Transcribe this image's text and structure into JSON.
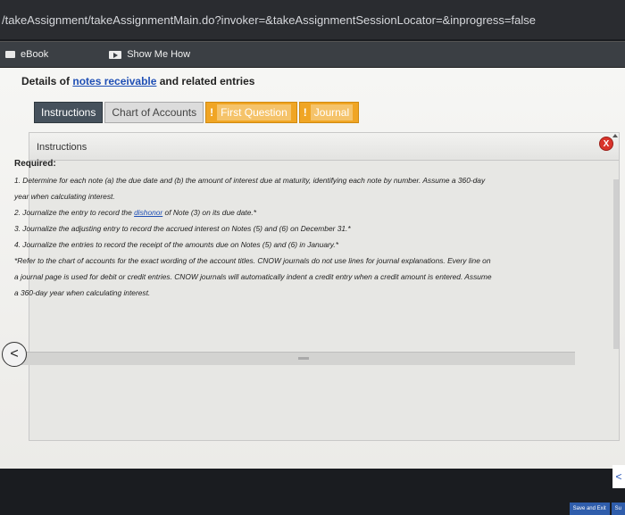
{
  "browser": {
    "url": "/takeAssignment/takeAssignmentMain.do?invoker=&takeAssignmentSessionLocator=&inprogress=false"
  },
  "toolbar": {
    "ebook_label": "eBook",
    "showme_label": "Show Me How"
  },
  "heading": {
    "prefix": "Details of ",
    "link": "notes receivable",
    "suffix": " and related entries"
  },
  "tabs": [
    {
      "label": "Instructions"
    },
    {
      "label": "Chart of Accounts"
    },
    {
      "bang": "!",
      "label": "First Question"
    },
    {
      "bang": "!",
      "label": "Journal"
    }
  ],
  "panel": {
    "title": "Instructions",
    "close_glyph": "X"
  },
  "content": {
    "required": "Required:",
    "line1": "1. Determine for each note (a) the due date and (b) the amount of interest due at maturity, identifying each note by number. Assume a 360-day",
    "line1b": "year when calculating interest.",
    "line2a": "2. Journalize the entry to record the ",
    "line2link": "dishonor",
    "line2b": " of Note (3) on its due date.*",
    "line3": "3. Journalize the adjusting entry to record the accrued interest on Notes (5) and (6) on December 31.*",
    "line4": "4. Journalize the entries to record the receipt of the amounts due on Notes (5) and (6) in January.*",
    "line5": "*Refer to the chart of accounts for the exact wording of the account titles. CNOW journals do not use lines for journal explanations. Every line on",
    "line6": "a journal page is used for debit or credit entries. CNOW journals will automatically indent a credit entry when a credit amount is entered. Assume",
    "line7": "a 360-day year when calculating interest."
  },
  "nav": {
    "prev_glyph": "<",
    "right_glyph": "<"
  },
  "footer": {
    "save_exit": "Save and Exit",
    "submit": "Su"
  }
}
